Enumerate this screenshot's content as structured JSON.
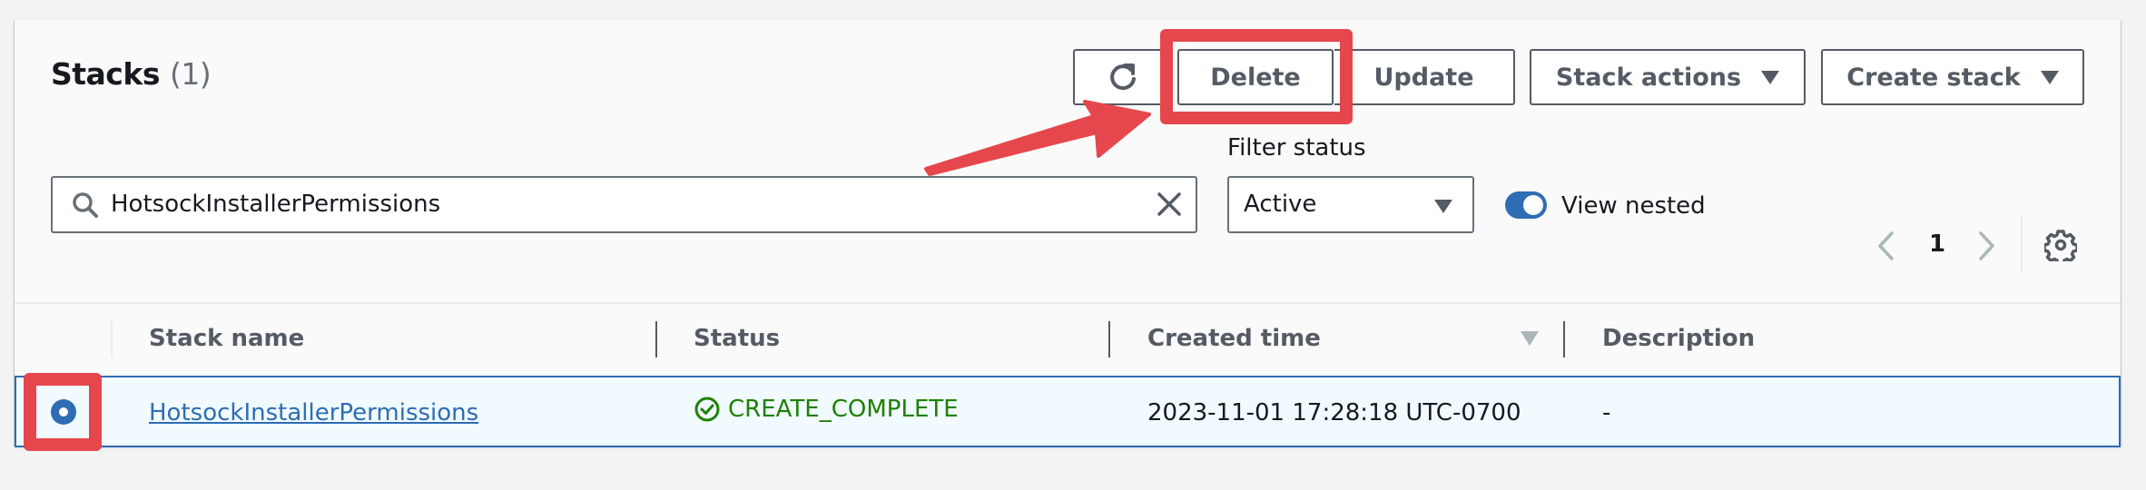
{
  "header": {
    "title": "Stacks",
    "count": "(1)"
  },
  "toolbar": {
    "refresh_icon": "refresh-icon",
    "delete_label": "Delete",
    "update_label": "Update",
    "stack_actions_label": "Stack actions",
    "create_stack_label": "Create stack"
  },
  "search": {
    "value": "HotsockInstallerPermissions",
    "icon": "search-icon",
    "clear_icon": "close-icon"
  },
  "filter": {
    "label": "Filter status",
    "selected": "Active"
  },
  "view_nested": {
    "label": "View nested",
    "enabled": true
  },
  "pagination": {
    "current_page": "1"
  },
  "table": {
    "columns": [
      "Stack name",
      "Status",
      "Created time",
      "Description"
    ],
    "sorted_column": "Created time",
    "rows": [
      {
        "selected": true,
        "name": "HotsockInstallerPermissions",
        "status": "CREATE_COMPLETE",
        "created": "2023-11-01 17:28:18 UTC-0700",
        "description": "-"
      }
    ]
  },
  "colors": {
    "accent": "#2e6db4",
    "success": "#1d8102",
    "annotation": "#e5474c"
  }
}
